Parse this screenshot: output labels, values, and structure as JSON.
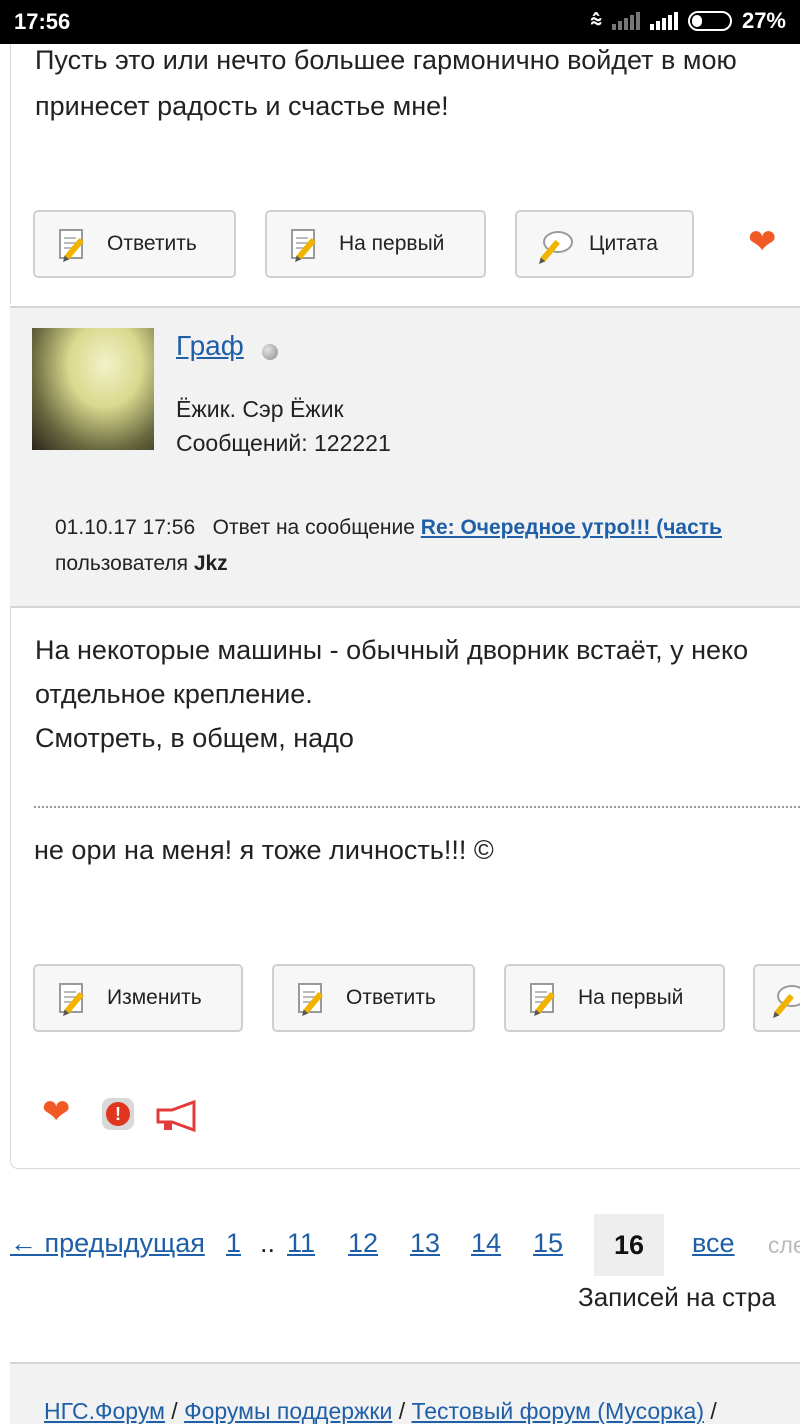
{
  "status_bar": {
    "time": "17:56",
    "battery": "27%"
  },
  "prev_post": {
    "text_line1": "Пусть это или нечто большее гармонично войдет в мою",
    "text_line2": "принесет радость и счастье мне!",
    "buttons": {
      "reply": "Ответить",
      "to_first": "На первый",
      "quote": "Цитата"
    }
  },
  "post": {
    "username": "Граф",
    "user_title": "Ёжик. Сэр Ёжик",
    "messages_count": "Сообщений: 122221",
    "date": "01.10.17 17:56",
    "reply_prefix": "Ответ на сообщение",
    "reply_link": "Re: Очередное утро!!! (часть",
    "reply_user_prefix": "пользователя",
    "reply_user": "Jkz",
    "body_line1": "На некоторые машины - обычный дворник встаёт, у неко",
    "body_line2": "отдельное крепление.",
    "body_line3": "Смотреть, в общем, надо",
    "signature": "не ори на меня! я тоже личность!!! ©",
    "buttons": {
      "edit": "Изменить",
      "reply": "Ответить",
      "to_first": "На первый"
    }
  },
  "pagination": {
    "prev": "← предыдущая",
    "pages": [
      "1",
      "11",
      "12",
      "13",
      "14",
      "15"
    ],
    "ellipsis": "..",
    "current": "16",
    "all": "все",
    "next": "сле"
  },
  "records_per_page": "Записей на стра",
  "breadcrumb": {
    "items": [
      "НГС.Форум",
      "Форумы поддержки",
      "Тестовый форум (Мусорка)"
    ],
    "separator": "/"
  }
}
